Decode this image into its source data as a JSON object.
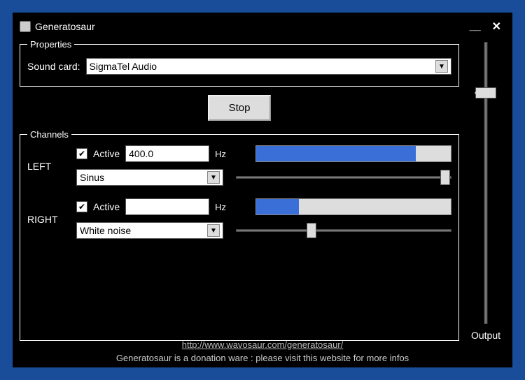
{
  "window": {
    "title": "Generatosaur"
  },
  "properties": {
    "legend": "Properties",
    "soundcard_label": "Sound card:",
    "soundcard_value": "SigmaTel Audio"
  },
  "controls": {
    "stop_label": "Stop"
  },
  "channels": {
    "legend": "Channels",
    "hz_label": "Hz",
    "active_label": "Active",
    "left": {
      "name": "LEFT",
      "active": true,
      "freq": "400.0",
      "wave": "Sinus",
      "level_pct": 82,
      "slider_pct": 97
    },
    "right": {
      "name": "RIGHT",
      "active": true,
      "freq": "",
      "wave": "White noise",
      "level_pct": 22,
      "slider_pct": 35
    }
  },
  "output": {
    "label": "Output",
    "slider_pct": 18
  },
  "footer": {
    "url": "http://www.wavosaur.com/generatosaur/",
    "tagline": "Generatosaur is a donation ware : please visit this website for more infos"
  }
}
